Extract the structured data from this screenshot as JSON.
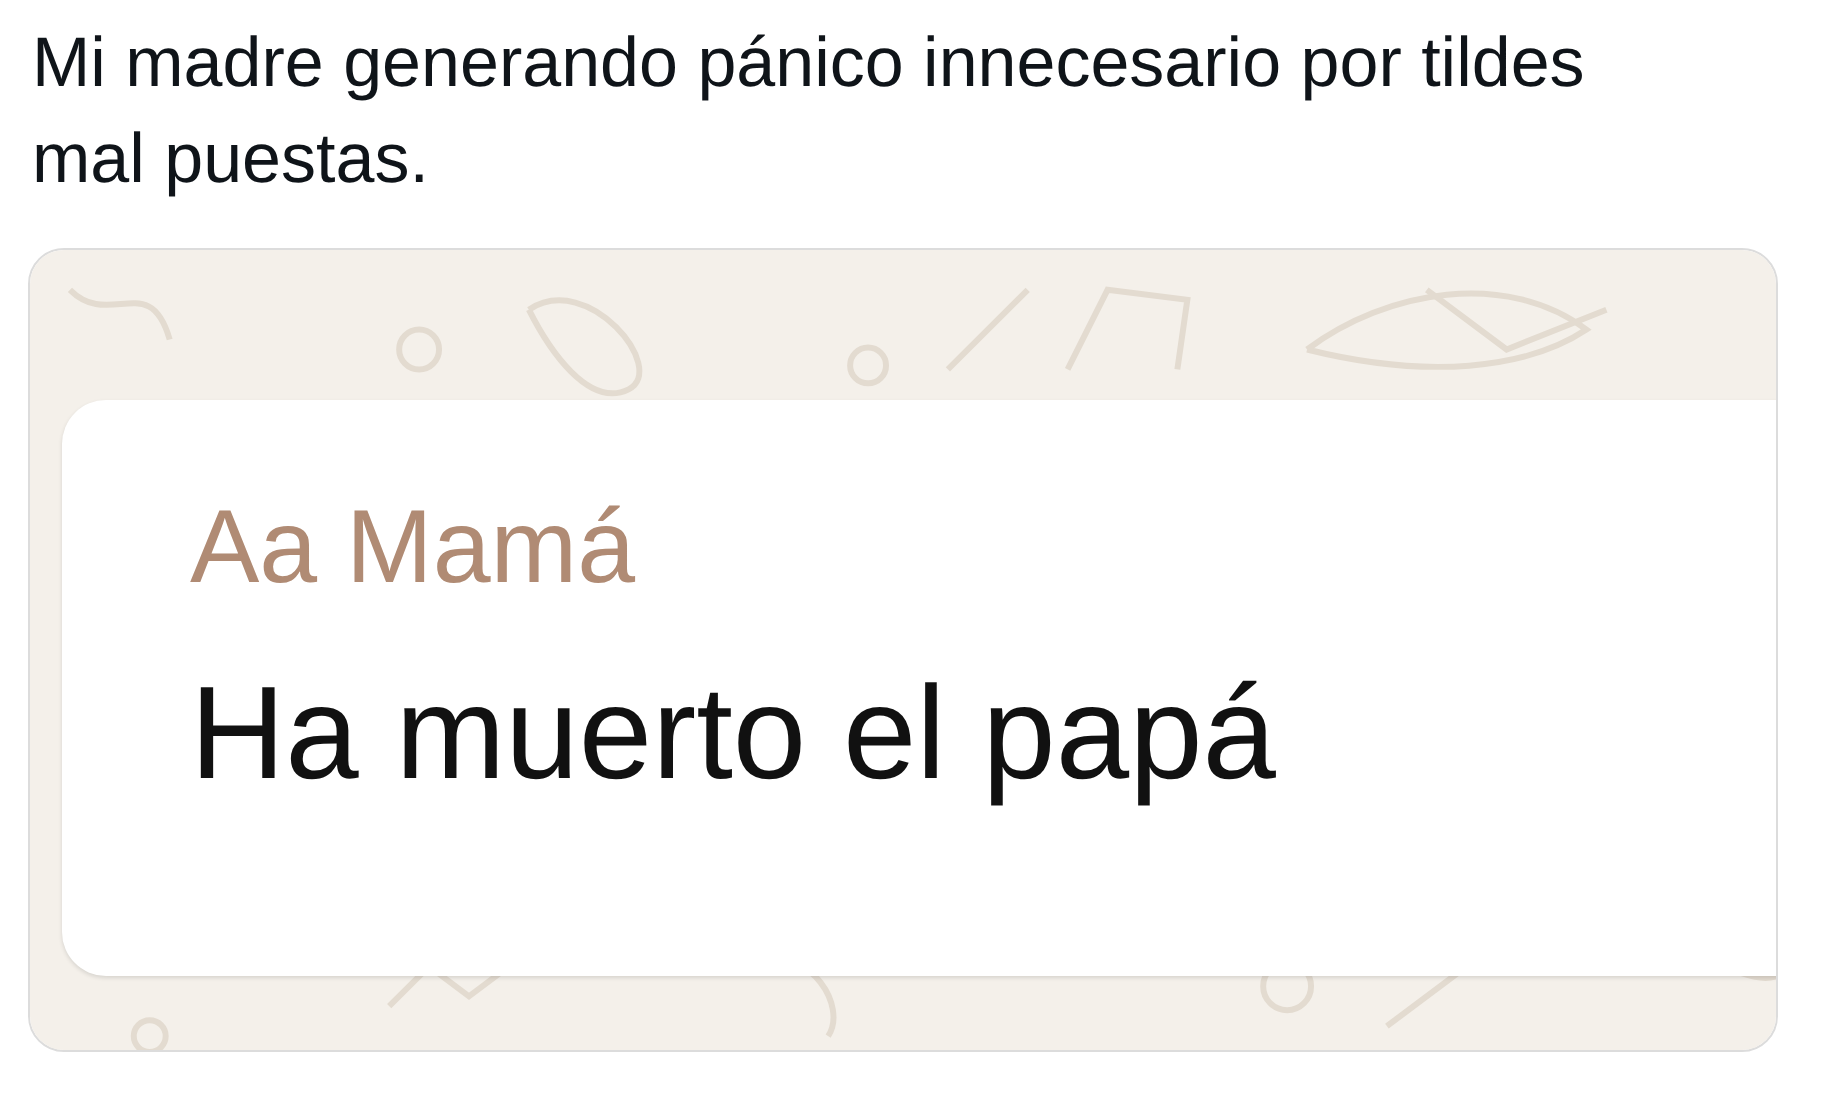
{
  "tweet": {
    "text": "Mi madre generando pánico innecesario por tildes mal puestas."
  },
  "chat_image": {
    "message": {
      "sender": "Aa Mamá",
      "text": "Ha muerto el papá"
    }
  }
}
